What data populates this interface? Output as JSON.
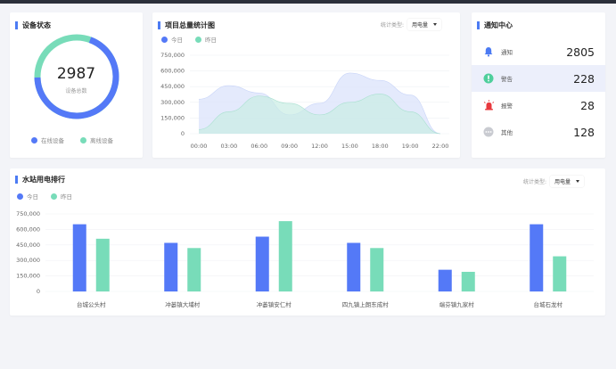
{
  "colors": {
    "today": "#5479f7",
    "yesterday": "#78dcb9",
    "accent": "#4c7bf3"
  },
  "device": {
    "title": "设备状态",
    "total": "2987",
    "total_label": "设备总数",
    "online_fraction": 0.69,
    "legend": {
      "online": "在线设备",
      "offline": "离线设备"
    }
  },
  "project": {
    "title": "项目总量统计图",
    "legend": {
      "today": "今日",
      "yesterday": "昨日"
    },
    "stat_label": "统计类型:",
    "stat_value": "用电量"
  },
  "notice": {
    "title": "通知中心",
    "items": [
      {
        "icon": "bell-icon",
        "label": "通知",
        "value": "2805"
      },
      {
        "icon": "warning-icon",
        "label": "警告",
        "value": "228"
      },
      {
        "icon": "alarm-icon",
        "label": "报警",
        "value": "28"
      },
      {
        "icon": "more-icon",
        "label": "其他",
        "value": "128"
      }
    ]
  },
  "station": {
    "title": "水站用电排行",
    "legend": {
      "today": "今日",
      "yesterday": "昨日"
    },
    "stat_label": "统计类型:",
    "stat_value": "用电量"
  },
  "chart_data": [
    {
      "type": "area",
      "title": "项目总量统计图",
      "x": [
        "00:00",
        "03:00",
        "06:00",
        "09:00",
        "12:00",
        "15:00",
        "18:00",
        "19:00",
        "22:00"
      ],
      "y_ticks": [
        "750,000",
        "600,000",
        "450,000",
        "300,000",
        "150,000",
        "0"
      ],
      "ylim": [
        0,
        750000
      ],
      "series": [
        {
          "name": "今日",
          "values": [
            330000,
            460000,
            390000,
            180000,
            290000,
            580000,
            510000,
            370000,
            0
          ]
        },
        {
          "name": "昨日",
          "values": [
            40000,
            210000,
            360000,
            290000,
            180000,
            300000,
            380000,
            210000,
            0
          ]
        }
      ]
    },
    {
      "type": "bar",
      "title": "水站用电排行",
      "categories": [
        "台城公头村",
        "冲蒌镇大埔村",
        "冲蒌镇安仁村",
        "四九镇上朗东成村",
        "端芬镇九家村",
        "台城石龙村"
      ],
      "y_ticks": [
        "750,000",
        "600,000",
        "450,000",
        "300,000",
        "150,000",
        "0"
      ],
      "ylim": [
        0,
        750000
      ],
      "series": [
        {
          "name": "今日",
          "values": [
            650000,
            470000,
            530000,
            470000,
            210000,
            650000
          ]
        },
        {
          "name": "昨日",
          "values": [
            510000,
            420000,
            680000,
            420000,
            190000,
            340000
          ]
        }
      ]
    }
  ]
}
